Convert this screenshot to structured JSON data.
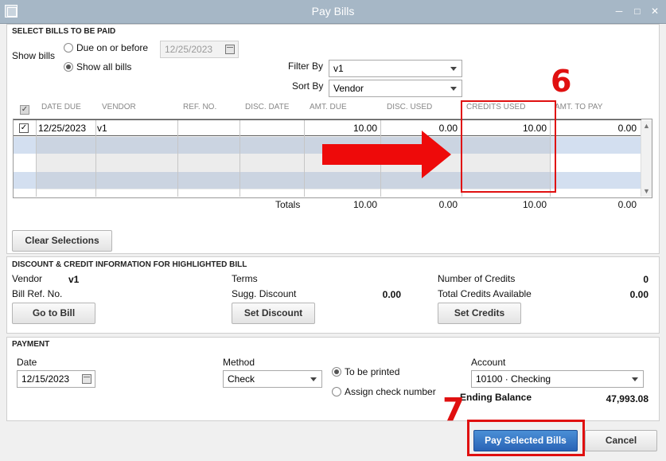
{
  "window": {
    "title": "Pay Bills"
  },
  "select_bills": {
    "section_title": "SELECT BILLS TO BE PAID",
    "show_bills_label": "Show bills",
    "due_on_before_label": "Due on or before",
    "due_date": "12/25/2023",
    "show_all_label": "Show all bills",
    "filter_by_label": "Filter By",
    "filter_by_value": "v1",
    "sort_by_label": "Sort By",
    "sort_by_value": "Vendor"
  },
  "grid": {
    "columns": [
      "DATE DUE",
      "VENDOR",
      "REF. NO.",
      "DISC. DATE",
      "AMT. DUE",
      "DISC. USED",
      "CREDITS USED",
      "AMT. TO PAY"
    ],
    "rows": [
      {
        "selected": true,
        "date_due": "12/25/2023",
        "vendor": "v1",
        "ref_no": "",
        "disc_date": "",
        "amt_due": "10.00",
        "disc_used": "0.00",
        "credits_used": "10.00",
        "amt_to_pay": "0.00"
      }
    ],
    "totals_label": "Totals",
    "totals": {
      "amt_due": "10.00",
      "disc_used": "0.00",
      "credits_used": "10.00",
      "amt_to_pay": "0.00"
    }
  },
  "clear_selections_label": "Clear Selections",
  "discount_credit": {
    "section_title": "DISCOUNT & CREDIT INFORMATION FOR HIGHLIGHTED BILL",
    "vendor_label": "Vendor",
    "vendor_value": "v1",
    "bill_ref_label": "Bill Ref. No.",
    "terms_label": "Terms",
    "sugg_discount_label": "Sugg. Discount",
    "sugg_discount_value": "0.00",
    "num_credits_label": "Number of Credits",
    "num_credits_value": "0",
    "total_credits_label": "Total Credits Available",
    "total_credits_value": "0.00",
    "go_to_bill_label": "Go to Bill",
    "set_discount_label": "Set Discount",
    "set_credits_label": "Set Credits"
  },
  "payment": {
    "section_title": "PAYMENT",
    "date_label": "Date",
    "date_value": "12/15/2023",
    "method_label": "Method",
    "method_value": "Check",
    "to_be_printed_label": "To be printed",
    "assign_check_label": "Assign check number",
    "account_label": "Account",
    "account_value": "10100 · Checking",
    "ending_balance_label": "Ending Balance",
    "ending_balance_value": "47,993.08"
  },
  "footer": {
    "pay_selected_label": "Pay Selected Bills",
    "cancel_label": "Cancel"
  },
  "annotations": {
    "step6": "6",
    "step7": "7",
    "color": "#e01010"
  }
}
